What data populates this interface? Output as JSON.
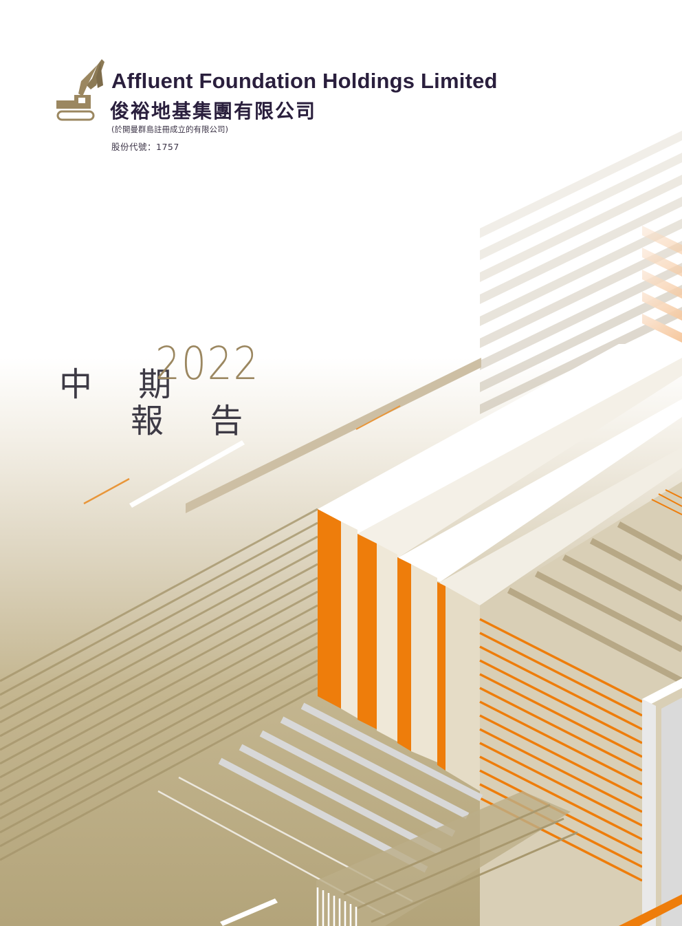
{
  "company": {
    "name_en": "Affluent Foundation Holdings Limited",
    "name_zh": "俊裕地基集團有限公司",
    "incorporation_note": "(於開曼群島註冊成立的有限公司)",
    "stock_code": "股份代號：1757"
  },
  "report": {
    "title_line1": "中 期",
    "title_line2": "報 告",
    "year": "2022"
  },
  "colors": {
    "navy": "#2a1f3d",
    "gold": "#9b8760",
    "orange": "#ee7d0b",
    "khaki": "#b3a47a"
  },
  "icons": {
    "logo": "excavator-icon"
  }
}
